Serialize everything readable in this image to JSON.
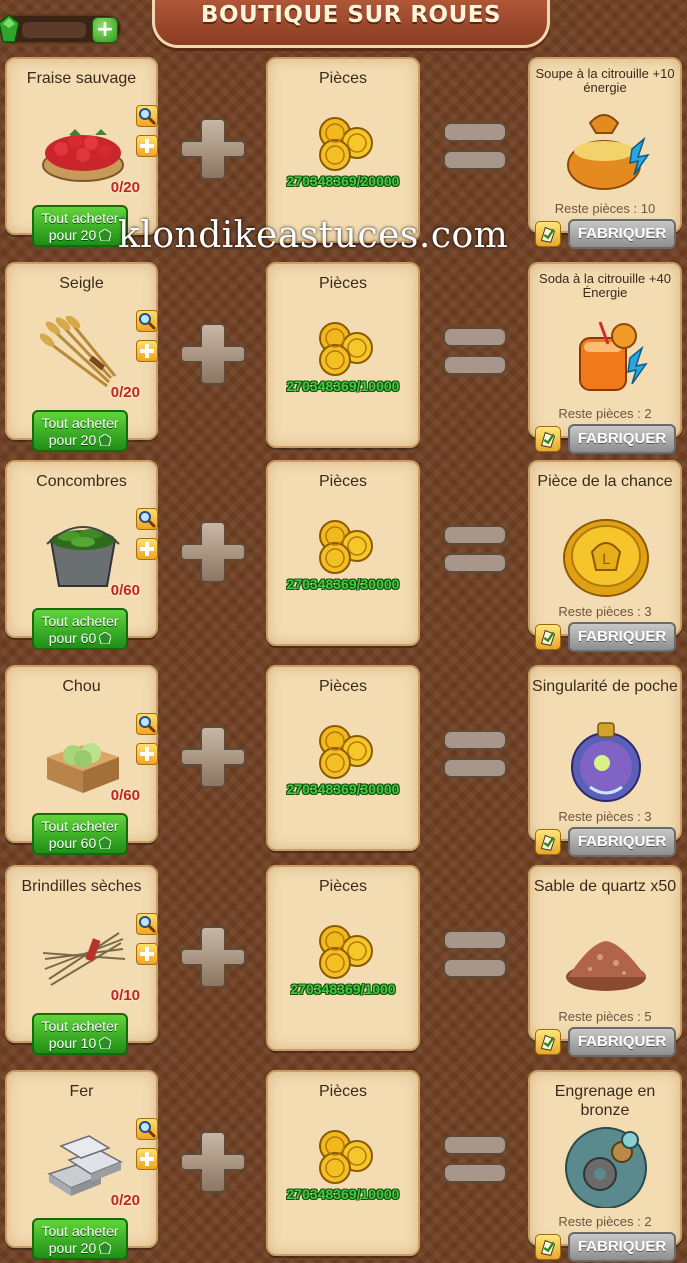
{
  "header": {
    "title": "BOUTIQUE SUR ROUES",
    "gem_count": "",
    "add_label": "+"
  },
  "coins_label": "Pièces",
  "fabricate_label": "FABRIQUER",
  "watermark": "klondikeastuces.com",
  "rows": [
    {
      "ingredient": {
        "name": "Fraise sauvage",
        "count": "0/20",
        "buy_line1": "Tout acheter",
        "buy_line2": "pour 20",
        "icon": "strawberry-basket-icon"
      },
      "coins": "270348369/20000",
      "result": {
        "name": "Soupe à la citrouille +10 énergie",
        "remaining": "Reste pièces : 10",
        "icon": "pumpkin-soup-icon"
      }
    },
    {
      "ingredient": {
        "name": "Seigle",
        "count": "0/20",
        "buy_line1": "Tout acheter",
        "buy_line2": "pour 20",
        "icon": "rye-bundle-icon"
      },
      "coins": "270348369/10000",
      "result": {
        "name": "Soda à la citrouille +40 Énergie",
        "remaining": "Reste pièces : 2",
        "icon": "pumpkin-soda-icon"
      }
    },
    {
      "ingredient": {
        "name": "Concombres",
        "count": "0/60",
        "buy_line1": "Tout acheter",
        "buy_line2": "pour 60",
        "icon": "cucumber-bucket-icon"
      },
      "coins": "270348369/30000",
      "result": {
        "name": "Pièce de la chance",
        "remaining": "Reste pièces : 3",
        "icon": "lucky-coin-icon"
      }
    },
    {
      "ingredient": {
        "name": "Chou",
        "count": "0/60",
        "buy_line1": "Tout acheter",
        "buy_line2": "pour 60",
        "icon": "cabbage-box-icon"
      },
      "coins": "270348369/30000",
      "result": {
        "name": "Singularité de poche",
        "remaining": "Reste pièces : 3",
        "icon": "pocket-singularity-icon"
      }
    },
    {
      "ingredient": {
        "name": "Brindilles sèches",
        "count": "0/10",
        "buy_line1": "Tout acheter",
        "buy_line2": "pour 10",
        "icon": "dry-twigs-icon"
      },
      "coins": "270348369/1000",
      "result": {
        "name": "Sable de quartz x50",
        "remaining": "Reste pièces : 5",
        "icon": "quartz-sand-icon"
      }
    },
    {
      "ingredient": {
        "name": "Fer",
        "count": "0/20",
        "buy_line1": "Tout acheter",
        "buy_line2": "pour 20",
        "icon": "iron-ingots-icon"
      },
      "coins": "270348369/10000",
      "result": {
        "name": "Engrenage en bronze",
        "remaining": "Reste pièces : 2",
        "icon": "bronze-gear-icon"
      }
    }
  ],
  "colors": {
    "background": "#6e3f22",
    "card": "#f3dcb2",
    "buy_button": "#2fa31e",
    "coin_count": "#39d13b",
    "count_red": "#c5221a",
    "fabricate_button": "#a9a9a9"
  }
}
